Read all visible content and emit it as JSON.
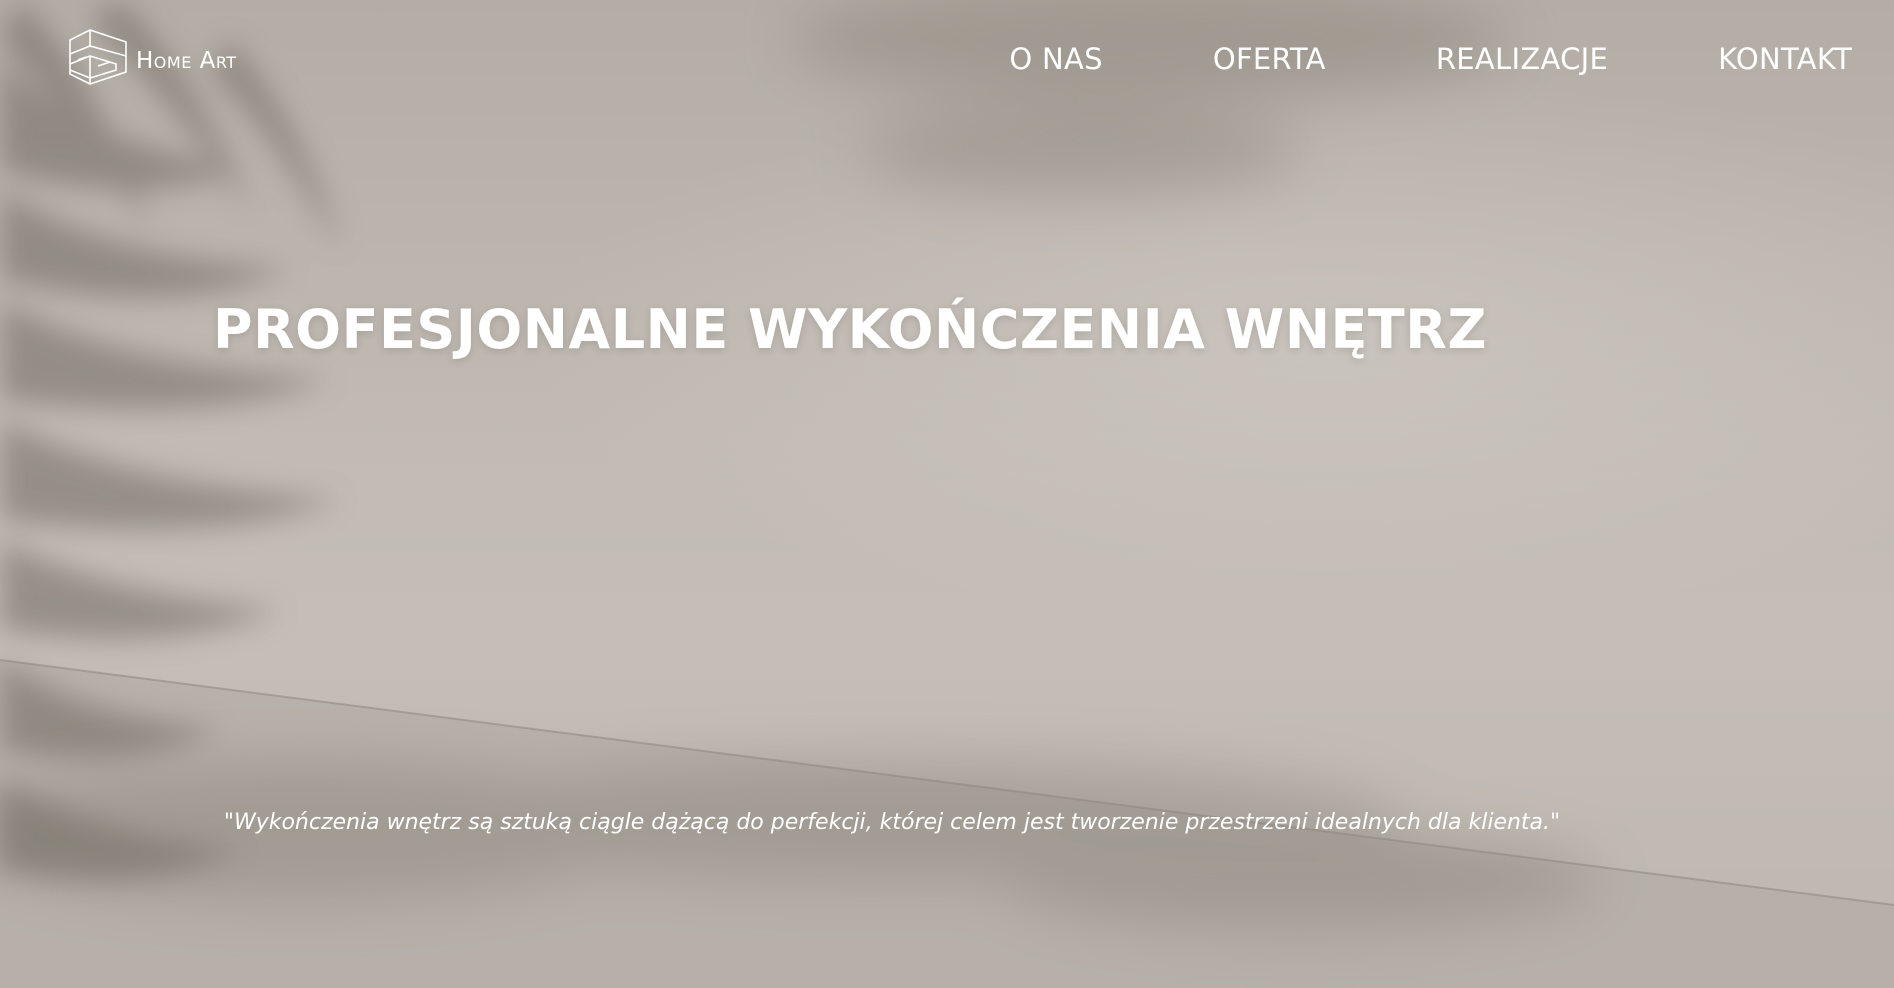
{
  "brand": {
    "name": "Home Art",
    "logo_icon": "home-art-logo-icon"
  },
  "nav": {
    "items": [
      {
        "label": "O NAS"
      },
      {
        "label": "OFERTA"
      },
      {
        "label": "REALIZACJE"
      },
      {
        "label": "KONTAKT"
      }
    ]
  },
  "hero": {
    "headline": "PROFESJONALNE WYKOŃCZENIA WNĘTRZ",
    "quote": "\"Wykończenia wnętrz są sztuką ciągle dążącą do perfekcji, której celem jest tworzenie przestrzeni idealnych dla klienta.\""
  },
  "colors": {
    "text": "#ffffff",
    "background": "#bdb7b0"
  }
}
